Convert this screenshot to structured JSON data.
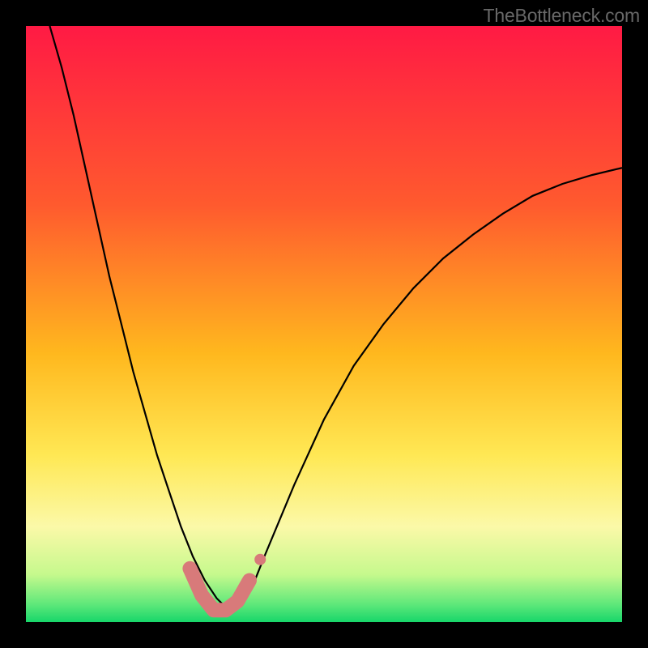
{
  "watermark": "TheBottleneck.com",
  "chart_data": {
    "type": "line",
    "title": "",
    "xlabel": "",
    "ylabel": "",
    "xlim": [
      0,
      1
    ],
    "ylim": [
      0,
      1
    ],
    "background": {
      "style": "vertical-gradient",
      "stops": [
        {
          "pos": 0.0,
          "color": "#ff1a44"
        },
        {
          "pos": 0.3,
          "color": "#ff5a2e"
        },
        {
          "pos": 0.55,
          "color": "#ffb81e"
        },
        {
          "pos": 0.72,
          "color": "#ffe854"
        },
        {
          "pos": 0.84,
          "color": "#fbf9a8"
        },
        {
          "pos": 0.92,
          "color": "#c6f98d"
        },
        {
          "pos": 0.97,
          "color": "#5fe87a"
        },
        {
          "pos": 1.0,
          "color": "#17d66a"
        }
      ]
    },
    "series": [
      {
        "name": "bottleneck-curve",
        "color": "#000000",
        "x": [
          0.04,
          0.06,
          0.08,
          0.1,
          0.12,
          0.14,
          0.16,
          0.18,
          0.2,
          0.22,
          0.24,
          0.26,
          0.28,
          0.3,
          0.32,
          0.34,
          0.36,
          0.38,
          0.4,
          0.45,
          0.5,
          0.55,
          0.6,
          0.65,
          0.7,
          0.75,
          0.8,
          0.85,
          0.9,
          0.95,
          1.0
        ],
        "y": [
          1.0,
          0.93,
          0.85,
          0.76,
          0.67,
          0.58,
          0.5,
          0.42,
          0.35,
          0.28,
          0.22,
          0.16,
          0.11,
          0.07,
          0.04,
          0.02,
          0.03,
          0.06,
          0.11,
          0.23,
          0.34,
          0.43,
          0.5,
          0.56,
          0.61,
          0.65,
          0.685,
          0.715,
          0.735,
          0.75,
          0.762
        ]
      }
    ],
    "marker_band": {
      "name": "optimum-marker",
      "color": "#d87a7a",
      "x": [
        0.275,
        0.295,
        0.315,
        0.335,
        0.355,
        0.375
      ],
      "y": [
        0.09,
        0.045,
        0.02,
        0.02,
        0.035,
        0.07
      ],
      "radius_small": 9,
      "radius_end": 7
    }
  }
}
